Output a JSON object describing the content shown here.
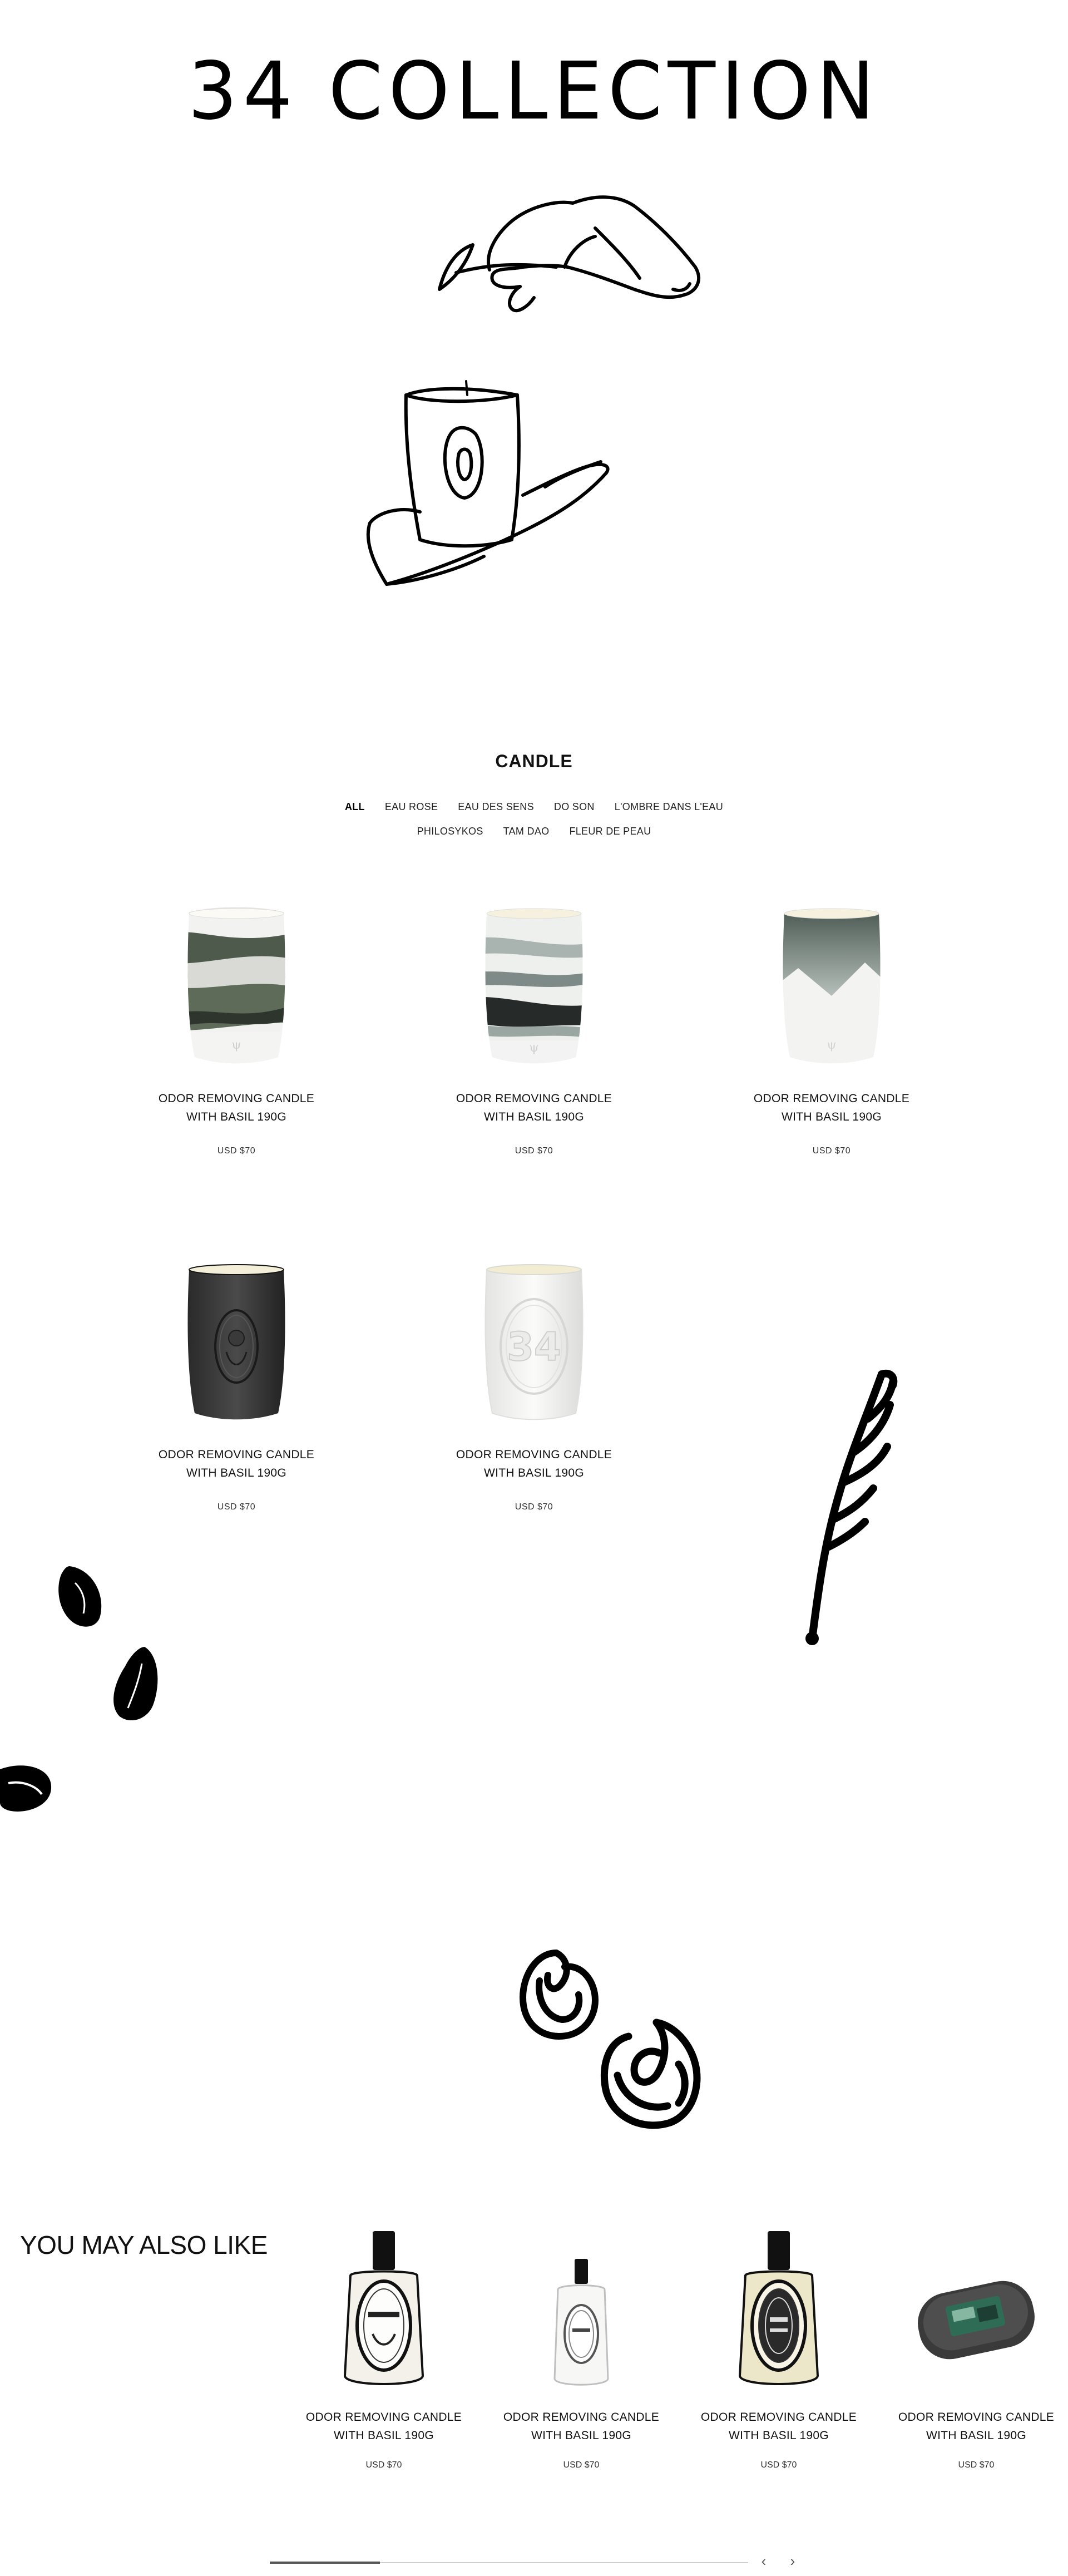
{
  "hero": {
    "title": "34 COLLECTION"
  },
  "section": {
    "title": "CANDLE"
  },
  "filters": {
    "row1": [
      "ALL",
      "EAU ROSE",
      "EAU DES SENS",
      "DO SON",
      "L'OMBRE DANS L'EAU"
    ],
    "row2": [
      "PHILOSYKOS",
      "TAM DAO",
      "FLEUR DE PEAU"
    ],
    "active": "ALL"
  },
  "products": [
    {
      "name_line1": "ODOR REMOVING CANDLE",
      "name_line2": "WITH BASIL 190G",
      "price": "USD $70",
      "style": "marble-green"
    },
    {
      "name_line1": "ODOR REMOVING CANDLE",
      "name_line2": "WITH BASIL 190G",
      "price": "USD $70",
      "style": "marble-grey"
    },
    {
      "name_line1": "ODOR REMOVING CANDLE",
      "name_line2": "WITH BASIL 190G",
      "price": "USD $70",
      "style": "mountain"
    },
    {
      "name_line1": "ODOR REMOVING CANDLE",
      "name_line2": "WITH BASIL 190G",
      "price": "USD $70",
      "style": "black"
    },
    {
      "name_line1": "ODOR REMOVING CANDLE",
      "name_line2": "WITH BASIL 190G",
      "price": "USD $70",
      "style": "white-34"
    }
  ],
  "also_like": {
    "title": "YOU MAY ALSO LIKE",
    "items": [
      {
        "name_line1": "ODOR REMOVING CANDLE",
        "name_line2": "WITH BASIL 190G",
        "price": "USD $70",
        "style": "perfume-large-dark"
      },
      {
        "name_line1": "ODOR REMOVING CANDLE",
        "name_line2": "WITH BASIL 190G",
        "price": "USD $70",
        "style": "perfume-small-white"
      },
      {
        "name_line1": "ODOR REMOVING CANDLE",
        "name_line2": "WITH BASIL 190G",
        "price": "USD $70",
        "style": "perfume-large-gold"
      },
      {
        "name_line1": "ODOR REMOVING CANDLE",
        "name_line2": "WITH BASIL 190G",
        "price": "USD $70",
        "style": "car-diffuser"
      }
    ]
  },
  "carousel": {
    "prev_icon": "chevron-left-icon",
    "next_icon": "chevron-right-icon",
    "prev_glyph": "‹",
    "next_glyph": "›",
    "progress": 0.23
  }
}
